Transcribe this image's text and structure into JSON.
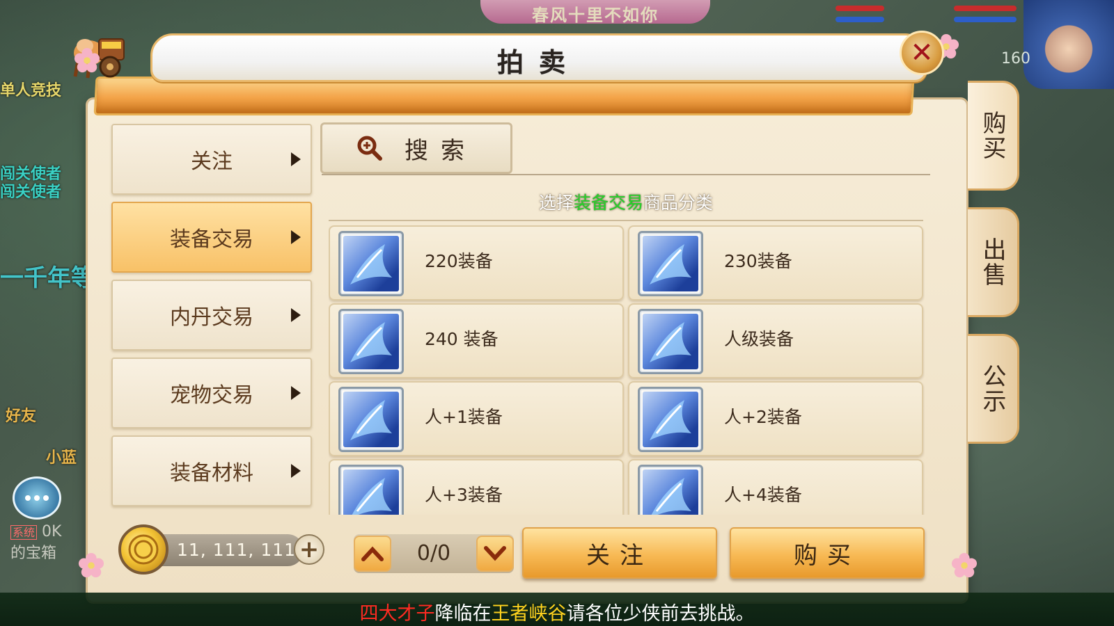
{
  "background": {
    "banner_text": "春风十里不如你",
    "level": "160",
    "side_texts": [
      "单人竞技",
      "闯关使者",
      "闯关使者",
      "一千年等一",
      "好友",
      "小蓝"
    ],
    "chat_lines": [
      "系统",
      "0K",
      "的宝箱"
    ]
  },
  "dialog": {
    "title": "拍卖",
    "close_icon": "close-icon",
    "categories": [
      {
        "label": "关注"
      },
      {
        "label": "装备交易"
      },
      {
        "label": "内丹交易"
      },
      {
        "label": "宠物交易"
      },
      {
        "label": "装备材料"
      }
    ],
    "active_category": 1,
    "search_label": "搜索",
    "hint": {
      "prefix": "选择",
      "highlight": "装备交易",
      "suffix": "商品分类"
    },
    "items": [
      {
        "label": "220装备"
      },
      {
        "label": "230装备"
      },
      {
        "label": "240 装备"
      },
      {
        "label": "人级装备"
      },
      {
        "label": "人+1装备"
      },
      {
        "label": "人+2装备"
      },
      {
        "label": "人+3装备"
      },
      {
        "label": "人+4装备"
      }
    ],
    "currency": {
      "amount": "11, 111, 111",
      "add_label": "+"
    },
    "pager": {
      "text": "0/0"
    },
    "follow_button": "关注",
    "buy_button": "购买",
    "tabs": [
      {
        "label": "购买"
      },
      {
        "label": "出售"
      },
      {
        "label": "公示"
      }
    ]
  },
  "ticker": {
    "part1": "四大才子",
    "part2": "降临在",
    "part3": "王者峡谷",
    "part4": "请各位少侠前去挑战。"
  },
  "colors": {
    "accent_orange": "#f7b954",
    "highlight_green": "#22d428",
    "ticker_red": "#ff2b22",
    "ticker_yellow": "#ffd21e"
  }
}
